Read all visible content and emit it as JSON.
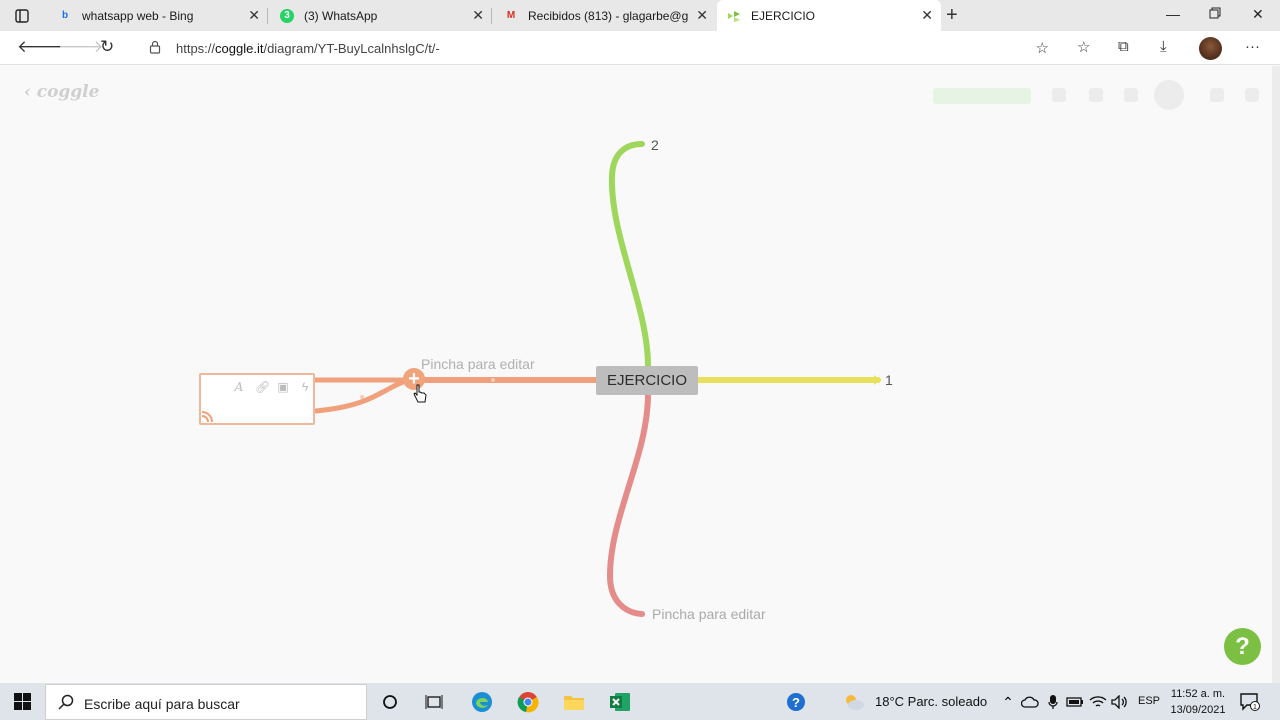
{
  "browser": {
    "tabs": [
      {
        "title": "whatsapp web - Bing",
        "icon": "bing-icon"
      },
      {
        "title": "(3) WhatsApp",
        "icon": "whatsapp-icon"
      },
      {
        "title": "Recibidos (813) - glagarbe@gma",
        "icon": "gmail-icon"
      },
      {
        "title": "EJERCICIO",
        "icon": "coggle-icon",
        "active": true
      }
    ],
    "url_prefix": "https://",
    "url_host": "coggle.it",
    "url_path": "/diagram/YT-BuyLcalnhslgC/t/-"
  },
  "page": {
    "logo": "coggle",
    "help_label": "?"
  },
  "mindmap": {
    "central_node": "EJERCICIO",
    "branches": [
      {
        "label": "2",
        "color": "#9ed75b",
        "direction": "up"
      },
      {
        "label": "1",
        "color": "#e8e05a",
        "direction": "right"
      },
      {
        "label": "Pincha para editar",
        "color": "#e48c8a",
        "direction": "down"
      },
      {
        "label": "Pincha para editar",
        "color": "#f0a07a",
        "direction": "left"
      }
    ]
  },
  "taskbar": {
    "search_placeholder": "Escribe aquí para buscar",
    "weather": "18°C  Parc. soleado",
    "language": "ESP",
    "time": "11:52 a. m.",
    "date": "13/09/2021",
    "notification_count": "1"
  }
}
